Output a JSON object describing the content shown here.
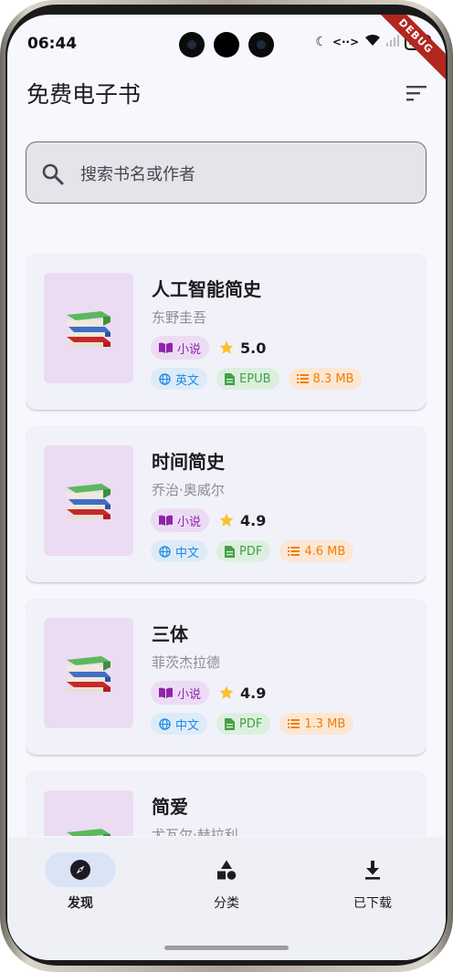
{
  "status_bar": {
    "time": "06:44",
    "battery": "100"
  },
  "debug_banner": "DEBUG",
  "app_bar": {
    "title": "免费电子书",
    "filter_icon": "filter-list-icon"
  },
  "search": {
    "placeholder": "搜索书名或作者",
    "icon": "search-icon"
  },
  "books": [
    {
      "title": "人工智能简史",
      "author": "东野圭吾",
      "genre": "小说",
      "rating": "5.0",
      "language": "英文",
      "format": "EPUB",
      "size": "8.3 MB"
    },
    {
      "title": "时间简史",
      "author": "乔治·奥威尔",
      "genre": "小说",
      "rating": "4.9",
      "language": "中文",
      "format": "PDF",
      "size": "4.6 MB"
    },
    {
      "title": "三体",
      "author": "菲茨杰拉德",
      "genre": "小说",
      "rating": "4.9",
      "language": "中文",
      "format": "PDF",
      "size": "1.3 MB"
    },
    {
      "title": "简爱",
      "author": "尤瓦尔·赫拉利",
      "genre": "",
      "rating": "",
      "language": "",
      "format": "",
      "size": ""
    }
  ],
  "bottom_nav": {
    "items": [
      {
        "label": "发现",
        "icon": "compass-icon",
        "active": true
      },
      {
        "label": "分类",
        "icon": "category-icon",
        "active": false
      },
      {
        "label": "已下载",
        "icon": "download-icon",
        "active": false
      }
    ]
  },
  "colors": {
    "genre": "#8e24aa",
    "language": "#1e88e5",
    "format": "#43a047",
    "size": "#f57c00",
    "star": "#fbc02d",
    "nav_active_pill": "#dbe3f6"
  }
}
